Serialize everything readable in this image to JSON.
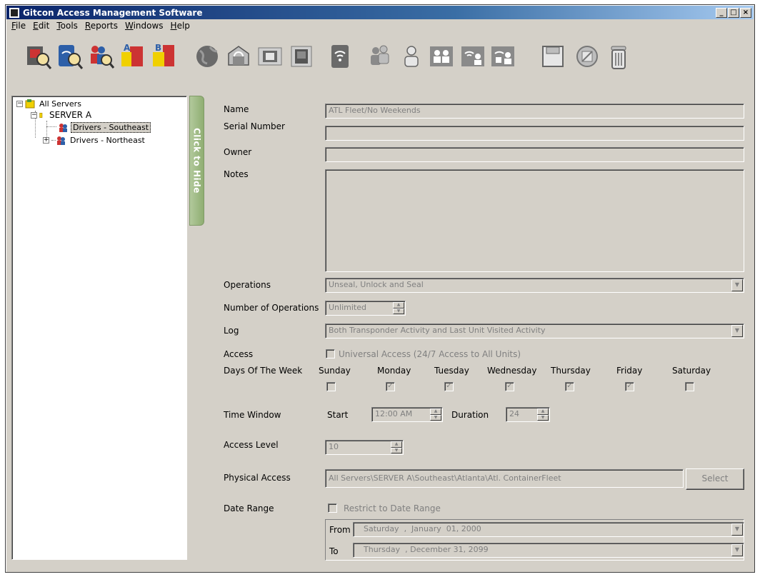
{
  "window": {
    "title": "Gitcon Access Management Software",
    "min": "_",
    "max": "□",
    "close": "×"
  },
  "menu": [
    {
      "u": "F",
      "rest": "ile"
    },
    {
      "u": "E",
      "rest": "dit"
    },
    {
      "u": "T",
      "rest": "ools"
    },
    {
      "u": "R",
      "rest": "eports"
    },
    {
      "u": "W",
      "rest": "indows"
    },
    {
      "u": "H",
      "rest": "elp"
    }
  ],
  "tree": {
    "root": "All Servers",
    "server": "SERVER A",
    "group1": "Drivers - Southeast",
    "group2": "Drivers - Northeast",
    "collapse_glyph": "−",
    "expand_glyph": "+"
  },
  "hide_tab": "Click to Hide",
  "form": {
    "name_label": "Name",
    "name_value": "ATL Fleet/No Weekends",
    "serial_label": "Serial Number",
    "serial_value": "",
    "owner_label": "Owner",
    "owner_value": "",
    "notes_label": "Notes",
    "notes_value": "",
    "operations_label": "Operations",
    "operations_value": "Unseal, Unlock and Seal",
    "num_ops_label": "Number of Operations",
    "num_ops_value": "Unlimited",
    "log_label": "Log",
    "log_value": "Both Transponder Activity and Last Unit Visited Activity",
    "access_label": "Access",
    "universal_access": "Universal Access (24/7 Access to All Units)",
    "days_label": "Days Of The Week",
    "days": [
      {
        "name": "Sunday",
        "checked": false
      },
      {
        "name": "Monday",
        "checked": true
      },
      {
        "name": "Tuesday",
        "checked": true
      },
      {
        "name": "Wednesday",
        "checked": true
      },
      {
        "name": "Thursday",
        "checked": true
      },
      {
        "name": "Friday",
        "checked": true
      },
      {
        "name": "Saturday",
        "checked": false
      }
    ],
    "time_window_label": "Time Window",
    "start_label": "Start",
    "start_value": "12:00 AM",
    "duration_label": "Duration",
    "duration_value": "24",
    "access_level_label": "Access Level",
    "access_level_value": "10",
    "physical_label": "Physical Access",
    "physical_value": "All Servers\\SERVER A\\Southeast\\Atlanta\\Atl. ContainerFleet",
    "select_button": "Select",
    "date_range_label": "Date Range",
    "restrict_label": "Restrict to Date Range",
    "from_label": "From",
    "from_value": "Saturday  ,  January  01, 2000",
    "to_label": "To",
    "to_value": "Thursday  , December 31, 2099",
    "check_glyph": "✓",
    "combo_glyph": "▼",
    "spin_up": "▲",
    "spin_down": "▼"
  },
  "toolbar_icons": [
    "find-card-icon",
    "find-server-icon",
    "find-users-icon",
    "report-a-icon",
    "report-b-icon",
    "globe-icon",
    "server-icon",
    "reader-icon",
    "device-icon",
    "wireless-icon",
    "user-group-icon",
    "user-icon",
    "add-users-icon",
    "wireless-users-icon",
    "linked-users-icon",
    "save-icon",
    "cancel-icon",
    "delete-icon"
  ]
}
